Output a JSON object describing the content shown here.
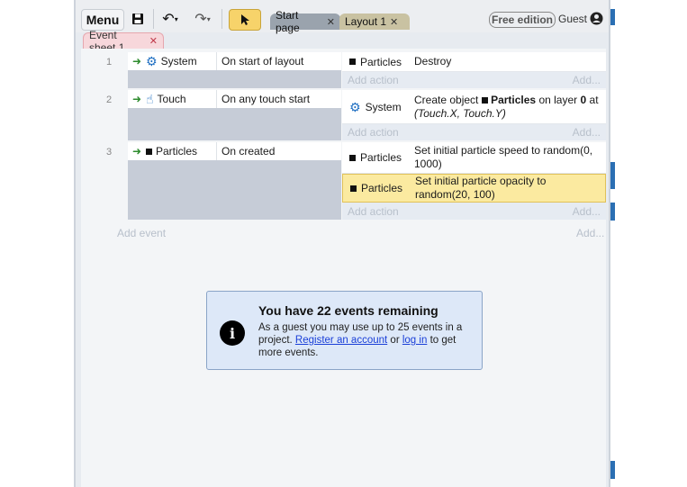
{
  "toolbar": {
    "menu_label": "Menu",
    "tabs": [
      {
        "label": "Start page"
      },
      {
        "label": "Layout 1"
      }
    ],
    "edition_badge": "Free edition",
    "user_label": "Guest"
  },
  "sheet_tab": {
    "label": "Event sheet 1"
  },
  "events": [
    {
      "number": "1",
      "condition": {
        "object": "System",
        "icon": "gear-icon",
        "text": "On start of layout"
      },
      "actions": [
        {
          "object": "Particles",
          "text": "Destroy"
        }
      ],
      "add_action": "Add action",
      "add_right": "Add..."
    },
    {
      "number": "2",
      "condition": {
        "object": "Touch",
        "icon": "hand-icon",
        "text": "On any touch start"
      },
      "actions": [
        {
          "object": "System",
          "text_prefix": "Create object",
          "text_obj": "Particles",
          "text_mid": "on layer",
          "text_layer": "0",
          "text_at": "at",
          "text_coords": "(Touch.X, Touch.Y)"
        }
      ],
      "add_action": "Add action",
      "add_right": "Add..."
    },
    {
      "number": "3",
      "condition": {
        "object": "Particles",
        "icon": "square-icon",
        "text": "On created"
      },
      "actions": [
        {
          "object": "Particles",
          "text": "Set initial particle speed to random(0, 1000)"
        },
        {
          "object": "Particles",
          "text": "Set initial particle opacity to random(20, 100)",
          "selected": true
        }
      ],
      "add_action": "Add action",
      "add_right": "Add..."
    }
  ],
  "add_event": "Add event",
  "add_event_right": "Add...",
  "notice": {
    "title": "You have 22 events remaining",
    "text_1": "As a guest you may use up to 25 events in a project.",
    "link_register": "Register an account",
    "text_or": "or",
    "link_login": "log in",
    "text_2": "to get more events."
  },
  "colors": {
    "accent_yellow": "#f7d36a",
    "selected_row": "#fbeaa0",
    "sheet_tab_pink": "#f7d7db",
    "notice_bg": "#dde8f8"
  }
}
